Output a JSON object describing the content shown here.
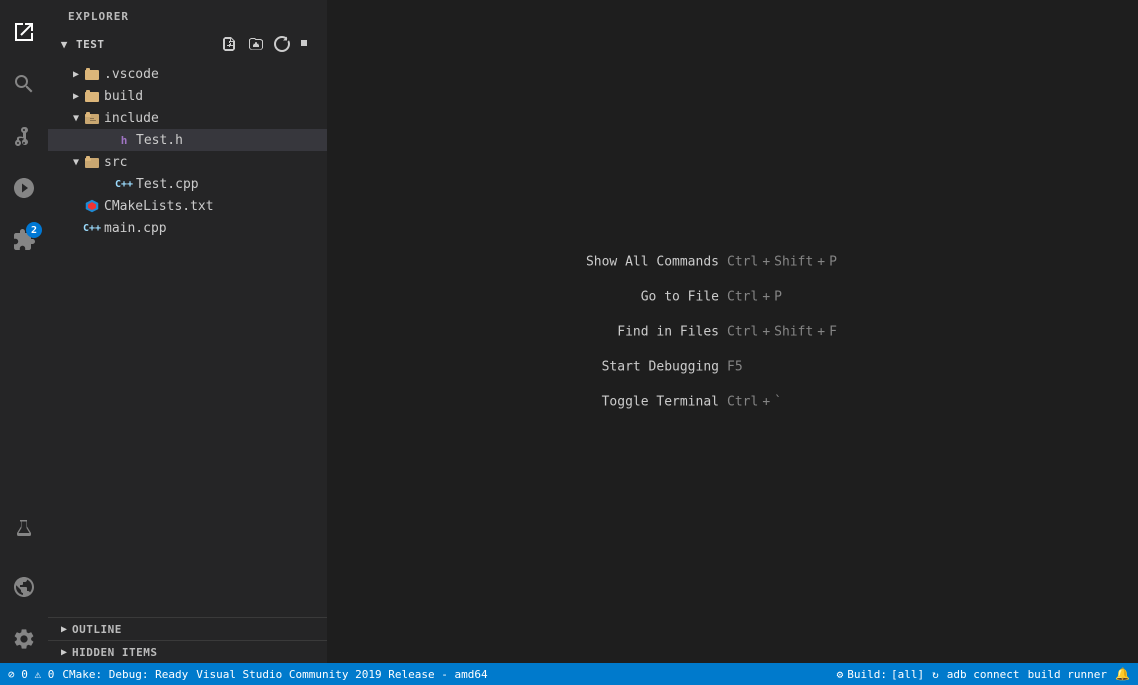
{
  "activityBar": {
    "icons": [
      {
        "name": "explorer-icon",
        "label": "Explorer",
        "active": true,
        "unicode": "⎘",
        "svgType": "files"
      },
      {
        "name": "search-icon",
        "label": "Search",
        "active": false,
        "svgType": "search"
      },
      {
        "name": "source-control-icon",
        "label": "Source Control",
        "active": false,
        "svgType": "git"
      },
      {
        "name": "debug-icon",
        "label": "Run and Debug",
        "active": false,
        "svgType": "debug"
      },
      {
        "name": "extensions-icon",
        "label": "Extensions",
        "active": false,
        "svgType": "extensions",
        "badge": "2"
      }
    ],
    "bottomIcons": [
      {
        "name": "flask-icon",
        "label": "Test",
        "svgType": "flask"
      },
      {
        "name": "remote-icon",
        "label": "Remote",
        "svgType": "remote"
      },
      {
        "name": "settings-icon",
        "label": "Settings",
        "svgType": "gear"
      },
      {
        "name": "notification-icon",
        "label": "Notifications",
        "svgType": "bell"
      }
    ]
  },
  "sidebar": {
    "header": "EXPLORER",
    "toolbar": {
      "title": "TEST",
      "buttons": [
        {
          "name": "new-file-btn",
          "title": "New File"
        },
        {
          "name": "new-folder-btn",
          "title": "New Folder"
        },
        {
          "name": "refresh-btn",
          "title": "Refresh"
        },
        {
          "name": "collapse-btn",
          "title": "Collapse All"
        }
      ]
    },
    "tree": [
      {
        "id": "vscode-folder",
        "indent": 1,
        "expanded": false,
        "type": "folder-special",
        "label": ".vscode",
        "icon": "folder-vscode"
      },
      {
        "id": "build-folder",
        "indent": 1,
        "expanded": false,
        "type": "folder",
        "label": "build",
        "icon": "folder"
      },
      {
        "id": "include-folder",
        "indent": 1,
        "expanded": true,
        "type": "folder",
        "label": "include",
        "icon": "folder-open"
      },
      {
        "id": "test-h",
        "indent": 2,
        "expanded": false,
        "type": "file",
        "label": "Test.h",
        "icon": "header",
        "selected": true
      },
      {
        "id": "src-folder",
        "indent": 1,
        "expanded": true,
        "type": "folder",
        "label": "src",
        "icon": "folder-open"
      },
      {
        "id": "test-cpp",
        "indent": 2,
        "expanded": false,
        "type": "file",
        "label": "Test.cpp",
        "icon": "cpp"
      },
      {
        "id": "cmakelists",
        "indent": 1,
        "expanded": false,
        "type": "file",
        "label": "CMakeLists.txt",
        "icon": "cmake"
      },
      {
        "id": "main-cpp",
        "indent": 1,
        "expanded": false,
        "type": "file",
        "label": "main.cpp",
        "icon": "cpp"
      }
    ],
    "sections": [
      {
        "name": "outline-section",
        "label": "OUTLINE",
        "expanded": false
      },
      {
        "name": "hidden-items-section",
        "label": "HIDDEN ITEMS",
        "expanded": false
      }
    ]
  },
  "shortcuts": [
    {
      "name": "Show All Commands",
      "keys": [
        "Ctrl",
        "+",
        "Shift",
        "+",
        "P"
      ]
    },
    {
      "name": "Go to File",
      "keys": [
        "Ctrl",
        "+",
        "P"
      ]
    },
    {
      "name": "Find in Files",
      "keys": [
        "Ctrl",
        "+",
        "Shift",
        "+",
        "F"
      ]
    },
    {
      "name": "Start Debugging",
      "keys": [
        "F5"
      ]
    },
    {
      "name": "Toggle Terminal",
      "keys": [
        "Ctrl",
        "+",
        "`"
      ]
    }
  ],
  "statusBar": {
    "left": [
      {
        "name": "errors-status",
        "text": "⊘ 0  ⚠ 0"
      },
      {
        "name": "cmake-status",
        "text": "CMake: Debug: Ready"
      },
      {
        "name": "vs-version-status",
        "text": "Visual Studio Community 2019 Release - amd64"
      }
    ],
    "right": [
      {
        "name": "build-status",
        "text": "⚙ Build:",
        "extra": "[all]"
      },
      {
        "name": "adb-status",
        "text": "adb connect"
      },
      {
        "name": "runner-status",
        "text": "build runner"
      },
      {
        "name": "sync-icon-status",
        "text": "↻"
      },
      {
        "name": "bell-status",
        "text": "🔔"
      }
    ]
  }
}
